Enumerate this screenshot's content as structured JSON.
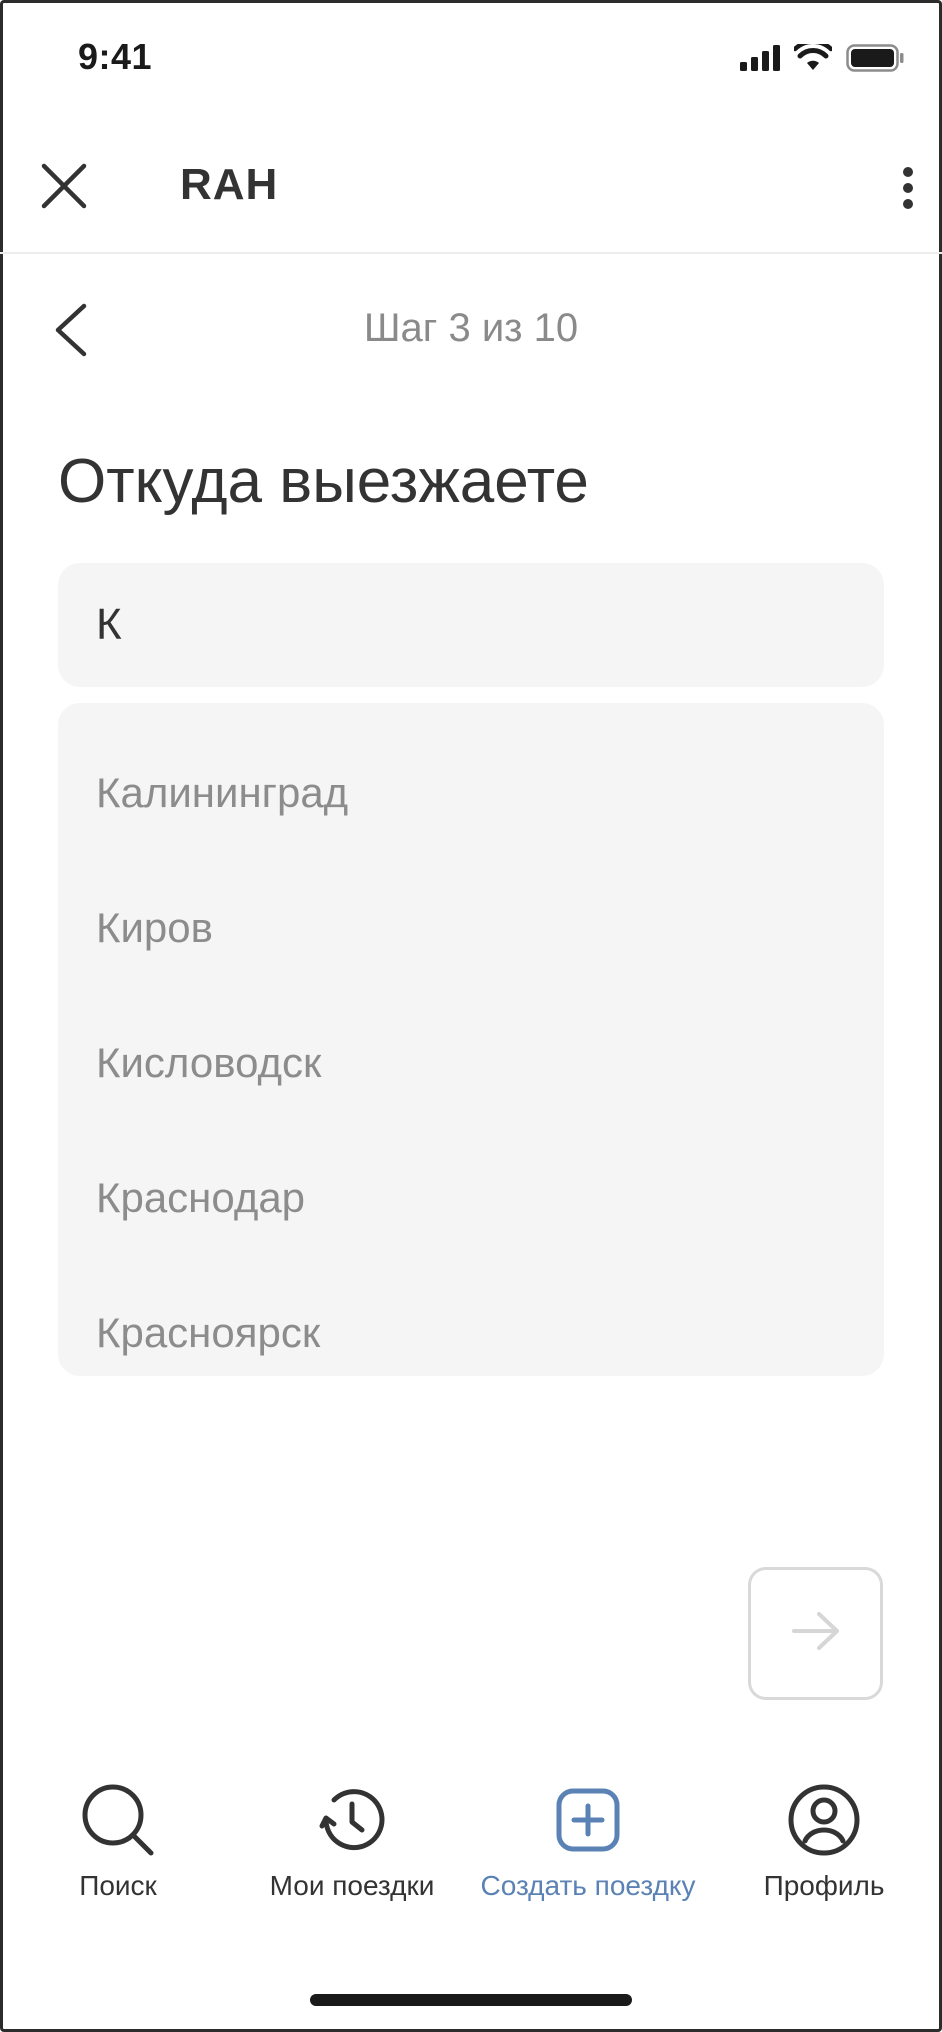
{
  "status_bar": {
    "time": "9:41"
  },
  "header": {
    "title": "RAH"
  },
  "step": {
    "label": "Шаг 3 из 10"
  },
  "page": {
    "title": "Откуда выезжаете"
  },
  "search": {
    "value": "К"
  },
  "suggestions": [
    "Калининград",
    "Киров",
    "Кисловодск",
    "Краснодар",
    "Красноярск"
  ],
  "tabs": [
    {
      "label": "Поиск",
      "icon": "search-icon",
      "active": false
    },
    {
      "label": "Мои поездки",
      "icon": "history-icon",
      "active": false
    },
    {
      "label": "Создать поездку",
      "icon": "plus-square-icon",
      "active": true
    },
    {
      "label": "Профиль",
      "icon": "profile-icon",
      "active": false
    }
  ],
  "colors": {
    "accent": "#5a82b4",
    "text": "#333333",
    "muted": "#8c8c8c",
    "field_bg": "#f5f5f5"
  }
}
